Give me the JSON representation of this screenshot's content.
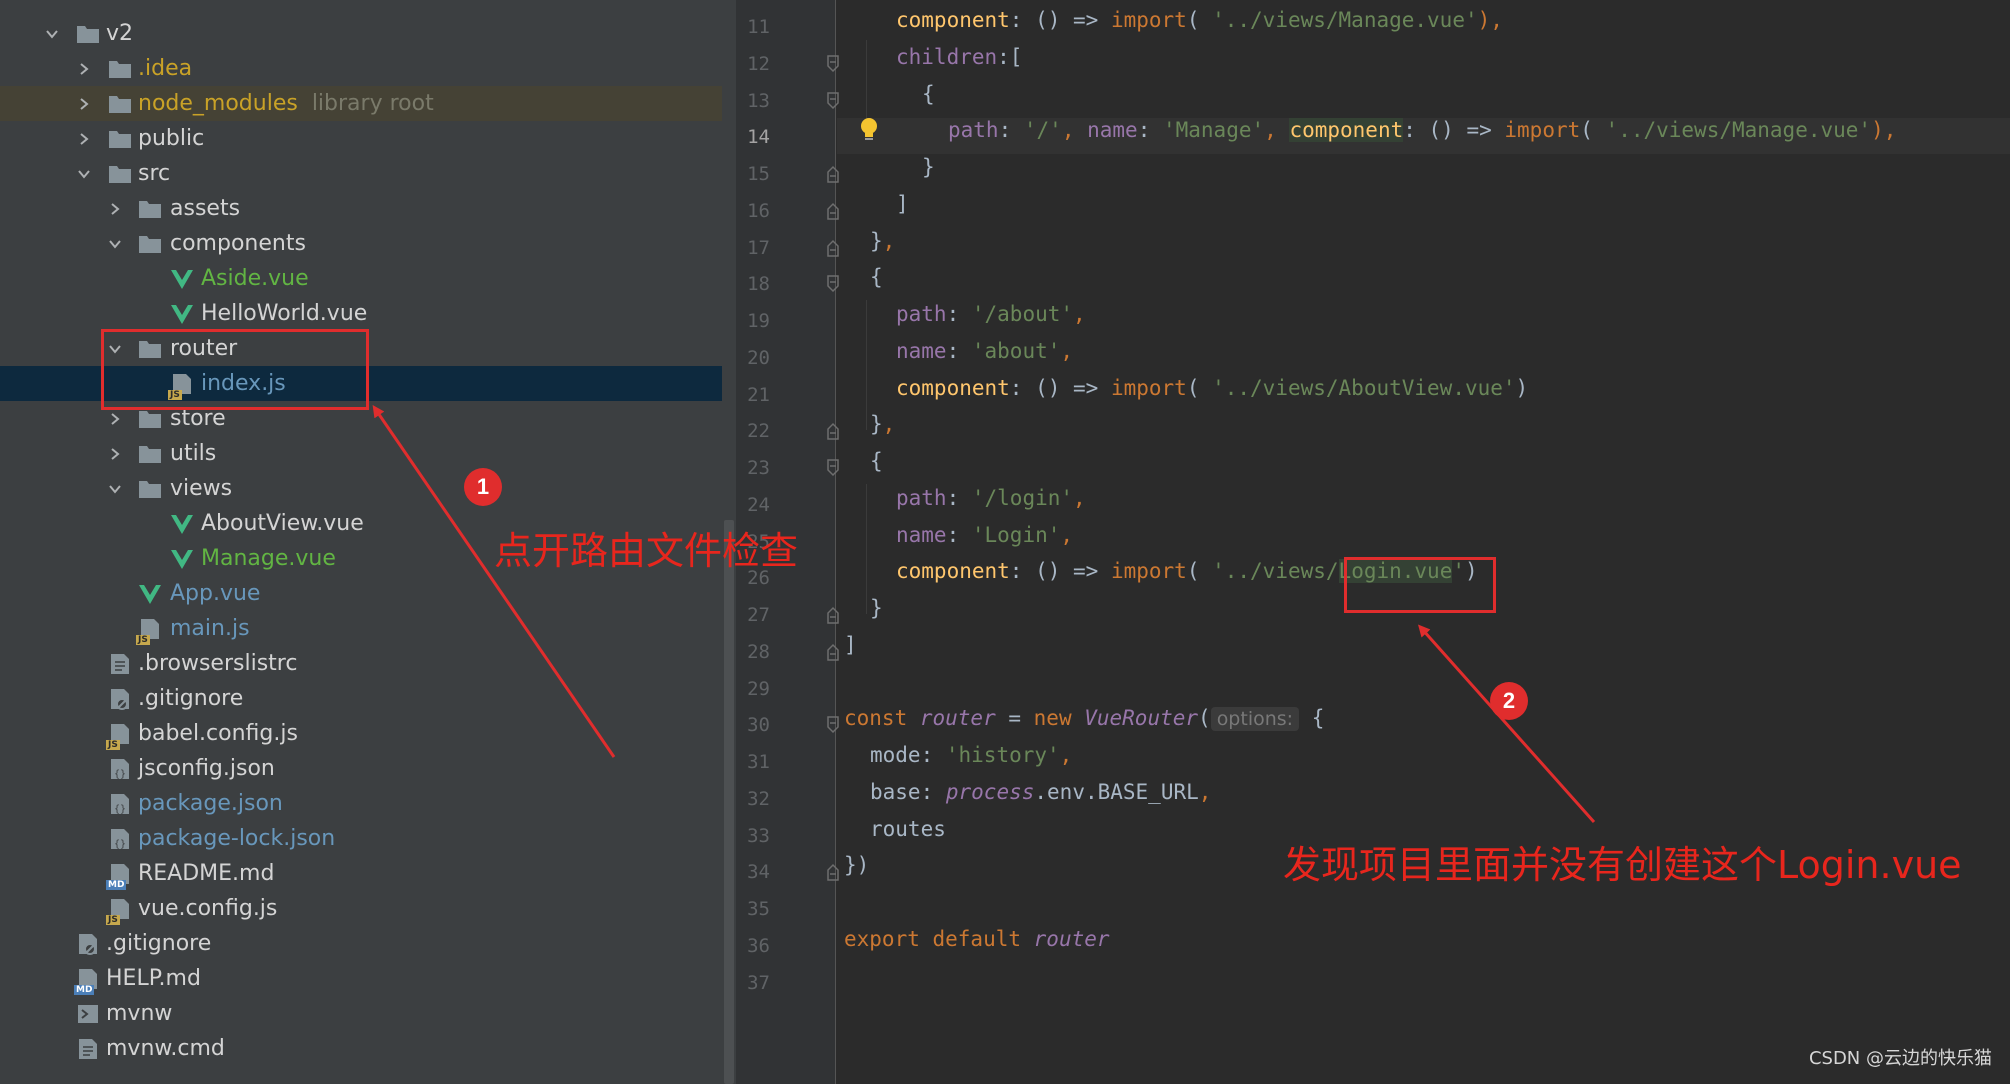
{
  "tree": {
    "items": [
      {
        "label": "v2",
        "hint": ""
      },
      {
        "label": ".idea",
        "hint": ""
      },
      {
        "label": "node_modules",
        "hint": "library root"
      },
      {
        "label": "public",
        "hint": ""
      },
      {
        "label": "src",
        "hint": ""
      },
      {
        "label": "assets",
        "hint": ""
      },
      {
        "label": "components",
        "hint": ""
      },
      {
        "label": "Aside.vue",
        "hint": ""
      },
      {
        "label": "HelloWorld.vue",
        "hint": ""
      },
      {
        "label": "router",
        "hint": ""
      },
      {
        "label": "index.js",
        "hint": ""
      },
      {
        "label": "store",
        "hint": ""
      },
      {
        "label": "utils",
        "hint": ""
      },
      {
        "label": "views",
        "hint": ""
      },
      {
        "label": "AboutView.vue",
        "hint": ""
      },
      {
        "label": "Manage.vue",
        "hint": ""
      },
      {
        "label": "App.vue",
        "hint": ""
      },
      {
        "label": "main.js",
        "hint": ""
      },
      {
        "label": ".browserslistrc",
        "hint": ""
      },
      {
        "label": ".gitignore",
        "hint": ""
      },
      {
        "label": "babel.config.js",
        "hint": ""
      },
      {
        "label": "jsconfig.json",
        "hint": ""
      },
      {
        "label": "package.json",
        "hint": ""
      },
      {
        "label": "package-lock.json",
        "hint": ""
      },
      {
        "label": "README.md",
        "hint": ""
      },
      {
        "label": "vue.config.js",
        "hint": ""
      },
      {
        "label": ".gitignore",
        "hint": ""
      },
      {
        "label": "HELP.md",
        "hint": ""
      },
      {
        "label": "mvnw",
        "hint": ""
      },
      {
        "label": "mvnw.cmd",
        "hint": ""
      }
    ]
  },
  "editor": {
    "line_numbers": [
      "11",
      "12",
      "13",
      "14",
      "15",
      "16",
      "17",
      "18",
      "19",
      "20",
      "21",
      "22",
      "23",
      "24",
      "25",
      "26",
      "27",
      "28",
      "29",
      "30",
      "31",
      "32",
      "33",
      "34",
      "35",
      "36",
      "37"
    ],
    "current_line": "14",
    "code": {
      "l11": {
        "a": "component",
        "b": ": () => ",
        "c": "import",
        "d": "( ",
        "e": "'../views/Manage.vue'",
        "f": "),"
      },
      "l12": {
        "a": "children",
        "b": ":["
      },
      "l13": {
        "a": "{"
      },
      "l14": {
        "a": "path",
        "b": ": ",
        "c": "'/'",
        "d": ", ",
        "e": "name",
        "f": ": ",
        "g": "'Manage'",
        "h": ", ",
        "i": "component",
        "j": ": () => ",
        "k": "import",
        "l": "( ",
        "m": "'../views/Manage.vue'",
        "n": "),"
      },
      "l15": {
        "a": "}"
      },
      "l16": {
        "a": "]"
      },
      "l17": {
        "a": "}",
        "b": ","
      },
      "l18": {
        "a": "{"
      },
      "l19": {
        "a": "path",
        "b": ": ",
        "c": "'/about'",
        "d": ","
      },
      "l20": {
        "a": "name",
        "b": ": ",
        "c": "'about'",
        "d": ","
      },
      "l21": {
        "a": "component",
        "b": ": () => ",
        "c": "import",
        "d": "( ",
        "e": "'../views/AboutView.vue'",
        "f": ")"
      },
      "l22": {
        "a": "}",
        "b": ","
      },
      "l23": {
        "a": "{"
      },
      "l24": {
        "a": "path",
        "b": ": ",
        "c": "'/login'",
        "d": ","
      },
      "l25": {
        "a": "name",
        "b": ": ",
        "c": "'Login'",
        "d": ","
      },
      "l26": {
        "a": "component",
        "b": ": () => ",
        "c": "import",
        "d": "( ",
        "e": "'../views/",
        "f": "Login.vue",
        "g": "'",
        "h": ")"
      },
      "l27": {
        "a": "}"
      },
      "l28": {
        "a": "]"
      },
      "l30": {
        "a": "const ",
        "b": "router",
        "c": " = ",
        "d": "new ",
        "e": "VueRouter",
        "f": "(",
        "g": "options:",
        "h": " {"
      },
      "l31": {
        "a": "mode",
        "b": ": ",
        "c": "'history'",
        "d": ","
      },
      "l32": {
        "a": "base",
        "b": ": ",
        "c": "process",
        "d": ".env.BASE_URL",
        "e": ","
      },
      "l33": {
        "a": "routes"
      },
      "l34": {
        "a": "})"
      },
      "l36": {
        "a": "export default ",
        "b": "router"
      }
    }
  },
  "annotations": {
    "step1_number": "1",
    "step1_text": "点开路由文件检查",
    "step2_number": "2",
    "step2_text": "发现项目里面并没有创建这个Login.vue",
    "color": "#e02d2d"
  },
  "watermark": "CSDN @云边的快乐猫"
}
